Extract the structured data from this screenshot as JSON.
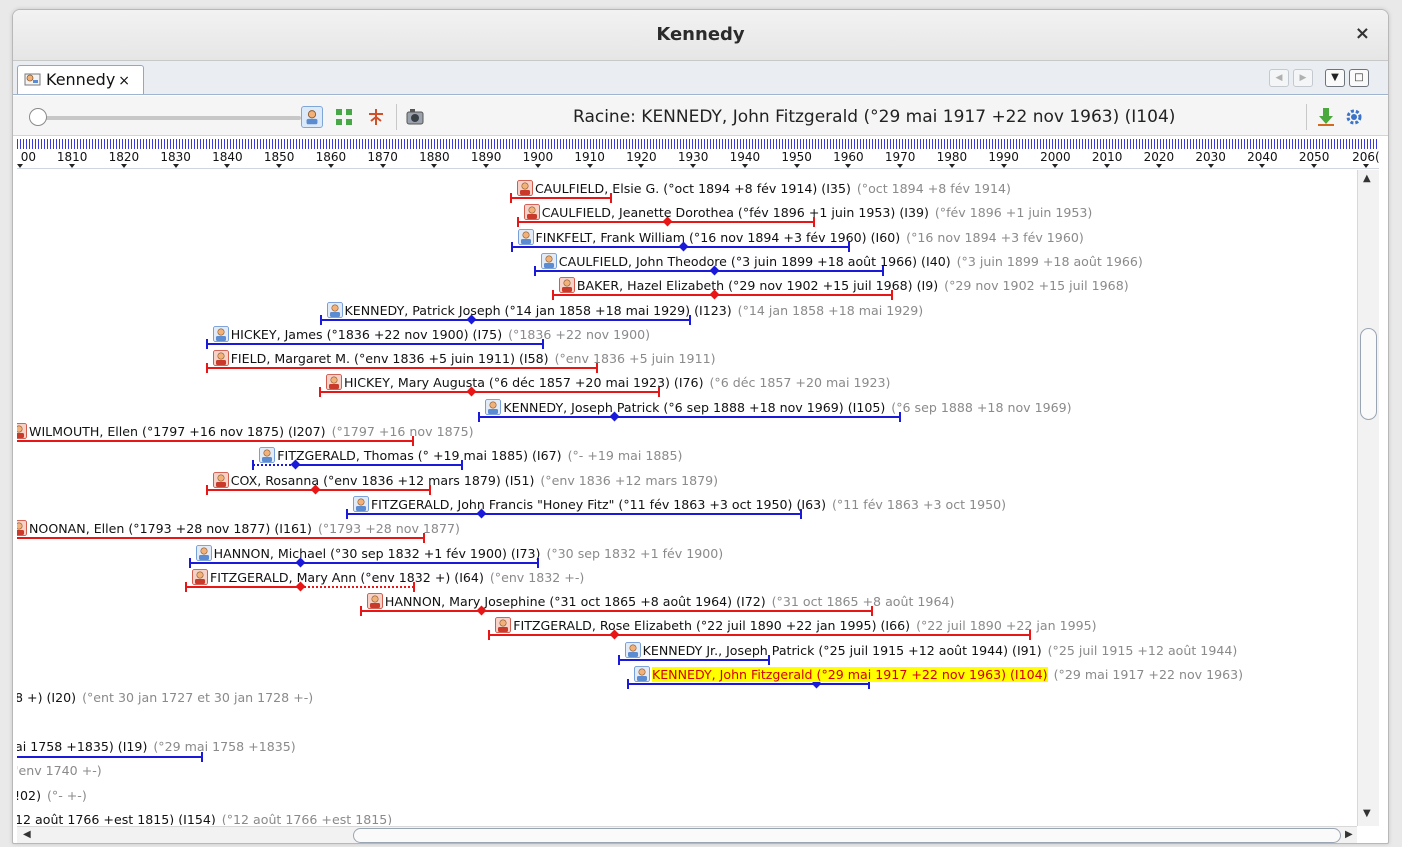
{
  "window": {
    "title": "Kennedy",
    "close_label": "×"
  },
  "tab": {
    "label": "Kennedy",
    "close_label": "×"
  },
  "toolbar": {
    "root_label": "Racine: KENNEDY, John Fitzgerald (°29 mai 1917 +22 nov 1963) (I104)",
    "icons": [
      "person-view-icon",
      "expand-tree-icon",
      "trim-icon",
      "camera-icon",
      "download-icon",
      "settings-icon"
    ]
  },
  "ruler": {
    "years": [
      "00",
      "1810",
      "1820",
      "1830",
      "1840",
      "1850",
      "1860",
      "1870",
      "1880",
      "1890",
      "1900",
      "1910",
      "1920",
      "1930",
      "1940",
      "1950",
      "1960",
      "1970",
      "1980",
      "1990",
      "2000",
      "2010",
      "2020",
      "2030",
      "2040",
      "2050",
      "206("
    ]
  },
  "colors": {
    "male": "#1a1ad8",
    "female": "#e81717",
    "root_highlight": "#ffff00",
    "root_text": "#d40000"
  },
  "persons": [
    {
      "sex": "f",
      "label": "CAULFIELD, Elsie G. (°oct 1894 +8 fév 1914) (I35)",
      "ghost": "(°oct 1894 +8 fév 1914)",
      "start": 1894.8,
      "end": 1914.1,
      "marks": []
    },
    {
      "sex": "f",
      "label": "CAULFIELD, Jeanette Dorothea (°fév 1896 +1 juin 1953) (I39)",
      "ghost": "(°fév 1896 +1 juin 1953)",
      "start": 1896.1,
      "end": 1953.4,
      "marks": [
        1925.0
      ]
    },
    {
      "sex": "m",
      "label": "FINKFELT, Frank William (°16 nov 1894 +3 fév 1960) (I60)",
      "ghost": "(°16 nov 1894 +3 fév 1960)",
      "start": 1894.9,
      "end": 1960.1,
      "marks": [
        1928.0
      ]
    },
    {
      "sex": "m",
      "label": "CAULFIELD, John Theodore (°3 juin 1899 +18 août 1966) (I40)",
      "ghost": "(°3 juin 1899 +18 août 1966)",
      "start": 1899.4,
      "end": 1966.6,
      "marks": [
        1934.0
      ]
    },
    {
      "sex": "f",
      "label": "BAKER, Hazel Elizabeth (°29 nov 1902 +15 juil 1968) (I9)",
      "ghost": "(°29 nov 1902 +15 juil 1968)",
      "start": 1902.9,
      "end": 1968.5,
      "marks": [
        1934.0
      ]
    },
    {
      "sex": "m",
      "label": "KENNEDY, Patrick Joseph (°14 jan 1858 +18 mai 1929) (I123)",
      "ghost": "(°14 jan 1858 +18 mai 1929)",
      "start": 1858.0,
      "end": 1929.4,
      "marks": [
        1887.0
      ]
    },
    {
      "sex": "m",
      "label": "HICKEY, James (°1836 +22 nov 1900) (I75)",
      "ghost": "(°1836 +22 nov 1900)",
      "start": 1836.0,
      "end": 1900.9,
      "marks": []
    },
    {
      "sex": "f",
      "label": "FIELD, Margaret M. (°env 1836 +5 juin 1911) (I58)",
      "ghost": "(°env 1836 +5 juin 1911)",
      "start": 1836.0,
      "end": 1911.4,
      "marks": []
    },
    {
      "sex": "f",
      "label": "HICKEY, Mary Augusta (°6 déc 1857 +20 mai 1923) (I76)",
      "ghost": "(°6 déc 1857 +20 mai 1923)",
      "start": 1857.9,
      "end": 1923.4,
      "marks": [
        1887.0
      ]
    },
    {
      "sex": "m",
      "label": "KENNEDY, Joseph Patrick (°6 sep 1888 +18 nov 1969) (I105)",
      "ghost": "(°6 sep 1888 +18 nov 1969)",
      "start": 1888.7,
      "end": 1969.9,
      "marks": [
        1914.8
      ]
    },
    {
      "sex": "f",
      "label": "WILMOUTH, Ellen (°1797 +16 nov 1875) (I207)",
      "ghost": "(°1797 +16 nov 1875)",
      "start": 1797.0,
      "end": 1875.9,
      "marks": []
    },
    {
      "sex": "m",
      "label": "FITZGERALD, Thomas (° +19 mai 1885) (I67)",
      "ghost": "(°- +19 mai 1885)",
      "start": 1845.0,
      "end": 1885.4,
      "marks": [
        1853.0
      ],
      "dotted_to": 1853.0
    },
    {
      "sex": "f",
      "label": "COX, Rosanna (°env 1836 +12 mars 1879) (I51)",
      "ghost": "(°env 1836 +12 mars 1879)",
      "start": 1836.0,
      "end": 1879.2,
      "marks": [
        1857.0
      ]
    },
    {
      "sex": "m",
      "label": "FITZGERALD, John Francis \"Honey Fitz\" (°11 fév 1863 +3 oct 1950) (I63)",
      "ghost": "(°11 fév 1863 +3 oct 1950)",
      "start": 1863.1,
      "end": 1950.8,
      "marks": [
        1889.0
      ]
    },
    {
      "sex": "f",
      "label": "NOONAN, Ellen (°1793 +28 nov 1877) (I161)",
      "ghost": "(°1793 +28 nov 1877)",
      "start": 1793.0,
      "end": 1877.9,
      "marks": []
    },
    {
      "sex": "m",
      "label": "HANNON, Michael (°30 sep 1832 +1 fév 1900) (I73)",
      "ghost": "(°30 sep 1832 +1 fév 1900)",
      "start": 1832.7,
      "end": 1900.1,
      "marks": [
        1854.0
      ]
    },
    {
      "sex": "f",
      "label": "FITZGERALD, Mary Ann (°env 1832 +) (I64)",
      "ghost": "(°env 1832 +-)",
      "start": 1832.0,
      "end": 1876.0,
      "marks": [
        1854.0
      ],
      "dotted_from": 1854.0
    },
    {
      "sex": "f",
      "label": "HANNON, Mary Josephine (°31 oct 1865 +8 août 1964) (I72)",
      "ghost": "(°31 oct 1865 +8 août 1964)",
      "start": 1865.8,
      "end": 1964.6,
      "marks": [
        1889.0
      ]
    },
    {
      "sex": "f",
      "label": "FITZGERALD, Rose Elizabeth (°22 juil 1890 +22 jan 1995) (I66)",
      "ghost": "(°22 juil 1890 +22 jan 1995)",
      "start": 1890.6,
      "end": 1995.1,
      "marks": [
        1914.8
      ]
    },
    {
      "sex": "m",
      "label": "KENNEDY Jr., Joseph Patrick (°25 juil 1915 +12 août 1944) (I91)",
      "ghost": "(°25 juil 1915 +12 août 1944)",
      "start": 1915.6,
      "end": 1944.6,
      "marks": []
    },
    {
      "sex": "m",
      "root": true,
      "label": "KENNEDY, John Fitzgerald (°29 mai 1917 +22 nov 1963) (I104)",
      "ghost": "(°29 mai 1917 +22 nov 1963)",
      "start": 1917.4,
      "end": 1963.9,
      "marks": [
        1953.7
      ]
    },
    {
      "sex": "m",
      "partial": true,
      "label": "8 +) (I20)",
      "ghost": "(°ent 30 jan 1727 et 30 jan 1728 +-)"
    },
    {
      "sex": "m",
      "partial": true,
      "label": "",
      "ghost": ""
    },
    {
      "sex": "m",
      "partial": true,
      "label": "ai 1758 +1835) (I19)",
      "ghost": "(°29 mai 1758 +1835)",
      "end": 1835.0
    },
    {
      "sex": "f",
      "partial": true,
      "label": "",
      "ghost": "'env 1740 +-)"
    },
    {
      "sex": "m",
      "partial": true,
      "label": "!02)",
      "ghost": "(°- +-)"
    },
    {
      "sex": "m",
      "partial": true,
      "label": "12 août 1766 +est 1815) (I154)",
      "ghost": "(°12 août 1766 +est 1815)"
    }
  ]
}
